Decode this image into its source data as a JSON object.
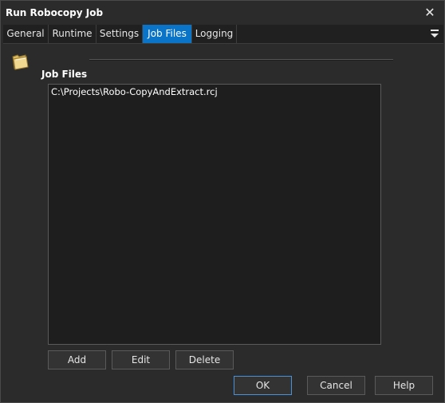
{
  "window": {
    "title": "Run Robocopy Job"
  },
  "tabs": [
    {
      "label": "General"
    },
    {
      "label": "Runtime"
    },
    {
      "label": "Settings"
    },
    {
      "label": "Job Files",
      "active": true
    },
    {
      "label": "Logging"
    }
  ],
  "job_files": {
    "group_label": "Job Files",
    "items": [
      "C:\\Projects\\Robo-CopyAndExtract.rcj"
    ],
    "add_label": "Add",
    "edit_label": "Edit",
    "delete_label": "Delete"
  },
  "footer": {
    "ok_label": "OK",
    "cancel_label": "Cancel",
    "help_label": "Help"
  },
  "colors": {
    "accent": "#0a74c8",
    "background": "#2b2b2b",
    "list_background": "#1e1e1e"
  },
  "icons": [
    "close-icon",
    "menu-icon",
    "folder-icon"
  ]
}
